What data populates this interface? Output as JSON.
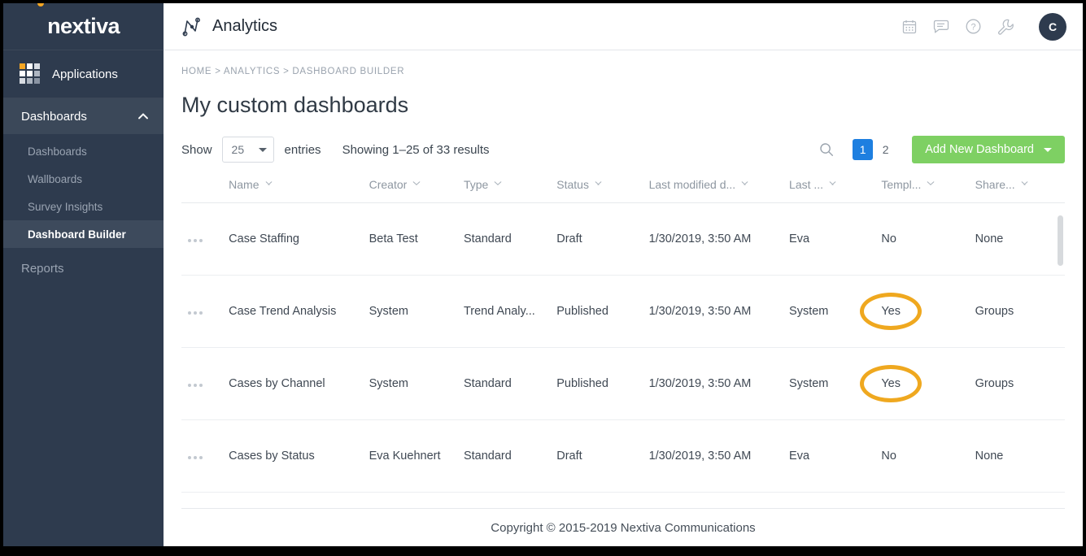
{
  "sidebar": {
    "logo": "nextiva",
    "applications_label": "Applications",
    "section": {
      "label": "Dashboards",
      "expanded": true,
      "items": [
        {
          "label": "Dashboards",
          "active": false
        },
        {
          "label": "Wallboards",
          "active": false
        },
        {
          "label": "Survey Insights",
          "active": false
        },
        {
          "label": "Dashboard Builder",
          "active": true
        }
      ]
    },
    "reports_label": "Reports"
  },
  "topbar": {
    "app_title": "Analytics",
    "icons": [
      "calendar-icon",
      "chat-icon",
      "help-icon",
      "wrench-icon"
    ],
    "avatar_initial": "C"
  },
  "breadcrumb": "HOME > ANALYTICS > DASHBOARD BUILDER",
  "page_title": "My custom dashboards",
  "toolbar": {
    "show_label": "Show",
    "page_size": "25",
    "entries_label": "entries",
    "showing_label": "Showing 1–25 of 33 results",
    "search_icon": "search-icon",
    "pages": [
      {
        "label": "1",
        "active": true
      },
      {
        "label": "2",
        "active": false
      }
    ],
    "add_button_label": "Add New Dashboard"
  },
  "table": {
    "columns": [
      "Name",
      "Creator",
      "Type",
      "Status",
      "Last modified d...",
      "Last ...",
      "Templ...",
      "Share..."
    ],
    "rows": [
      {
        "name": "Case Staffing",
        "creator": "Beta Test",
        "type": "Standard",
        "status": "Draft",
        "last_modified": "1/30/2019, 3:50 AM",
        "last_by": "Eva",
        "template": "No",
        "template_highlighted": false,
        "shared": "None"
      },
      {
        "name": "Case Trend Analysis",
        "creator": "System",
        "type": "Trend Analy...",
        "status": "Published",
        "last_modified": "1/30/2019, 3:50 AM",
        "last_by": "System",
        "template": "Yes",
        "template_highlighted": true,
        "shared": "Groups"
      },
      {
        "name": "Cases by Channel",
        "creator": "System",
        "type": "Standard",
        "status": "Published",
        "last_modified": "1/30/2019, 3:50 AM",
        "last_by": "System",
        "template": "Yes",
        "template_highlighted": true,
        "shared": "Groups"
      },
      {
        "name": "Cases by Status",
        "creator": "Eva Kuehnert",
        "type": "Standard",
        "status": "Draft",
        "last_modified": "1/30/2019, 3:50 AM",
        "last_by": "Eva",
        "template": "No",
        "template_highlighted": false,
        "shared": "None"
      }
    ]
  },
  "footer": "Copyright © 2015-2019 Nextiva Communications",
  "colors": {
    "sidebar_bg": "#2e3b4e",
    "sidebar_active": "#3d4a5c",
    "brand_orange": "#f5a623",
    "accent_green": "#7ed063",
    "pager_blue": "#1e7fe0",
    "highlight_ellipse": "#efa81f"
  }
}
